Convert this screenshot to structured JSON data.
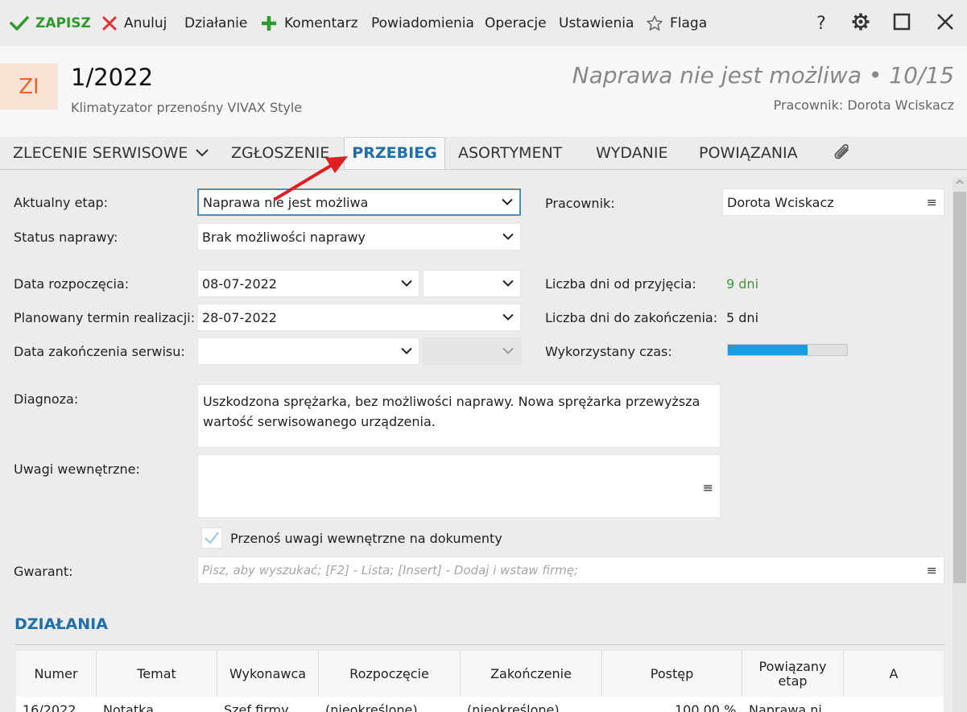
{
  "toolbar": {
    "save_label": "ZAPISZ",
    "cancel_label": "Anuluj",
    "action_label": "Działanie",
    "comment_label": "Komentarz",
    "notifications_label": "Powiadomienia",
    "operations_label": "Operacje",
    "settings_label": "Ustawienia",
    "flag_label": "Flaga",
    "help_label": "?"
  },
  "header": {
    "avatar_text": "ZI",
    "doc_number": "1/2022",
    "doc_subtitle": "Klimatyzator przenośny VIVAX Style",
    "status_text": "Naprawa nie jest możliwa • 10/15",
    "worker_text": "Pracownik: Dorota Wciskacz"
  },
  "tabs": {
    "service_order": "ZLECENIE SERWISOWE",
    "report": "ZGŁOSZENIE",
    "progress": "PRZEBIEG",
    "assortment": "ASORTYMENT",
    "issue": "WYDANIE",
    "relations": "POWIĄZANIA"
  },
  "form": {
    "current_stage_label": "Aktualny etap:",
    "current_stage_value": "Naprawa nie jest możliwa",
    "repair_status_label": "Status naprawy:",
    "repair_status_value": "Brak możliwości naprawy",
    "start_date_label": "Data rozpoczęcia:",
    "start_date_value": "08-07-2022",
    "planned_date_label": "Planowany termin realizacji:",
    "planned_date_value": "28-07-2022",
    "end_date_label": "Data zakończenia serwisu:",
    "end_date_value": "",
    "worker_label": "Pracownik:",
    "worker_value": "Dorota Wciskacz",
    "days_since_label": "Liczba dni od przyjęcia:",
    "days_since_value": "9 dni",
    "days_to_end_label": "Liczba dni do zakończenia:",
    "days_to_end_value": "5 dni",
    "time_used_label": "Wykorzystany czas:",
    "time_used_fraction": 0.67,
    "diagnosis_label": "Diagnoza:",
    "diagnosis_value": "Uszkodzona sprężarka, bez możliwości naprawy. Nowa sprężarka przewyższa wartość serwisowanego urządzenia.",
    "internal_notes_label": "Uwagi wewnętrzne:",
    "internal_notes_value": "",
    "transfer_notes_label": "Przenoś uwagi wewnętrzne na dokumenty",
    "transfer_notes_checked": true,
    "guarantor_label": "Gwarant:",
    "guarantor_placeholder": "Pisz, aby wyszukać; [F2] - Lista; [Insert] - Dodaj i wstaw firmę;"
  },
  "actions": {
    "title": "DZIAŁANIA",
    "columns": [
      "Numer",
      "Temat",
      "Wykonawca",
      "Rozpoczęcie",
      "Zakończenie",
      "Postęp",
      "Powiązany etap",
      "A"
    ],
    "rows": [
      [
        "16/2022",
        "Notatka",
        "Szef firmy",
        "(nieokreślone)",
        "(nieokreślone)",
        "100,00 %",
        "Naprawa ni",
        ""
      ]
    ]
  },
  "colors": {
    "accent": "#1f6fa8",
    "save_green": "#2e9a2e",
    "cancel_red": "#e03030",
    "progress_blue": "#1b9be0",
    "days_green": "#3a9a3a",
    "annotation_arrow": "#e02020"
  },
  "icons": {
    "save": "check-icon",
    "cancel": "x-icon",
    "comment": "plus-icon",
    "flag": "star-icon",
    "help": "question-icon",
    "settings": "gear-icon",
    "maximize": "square-icon",
    "close": "close-icon",
    "attachment": "paperclip-icon"
  }
}
